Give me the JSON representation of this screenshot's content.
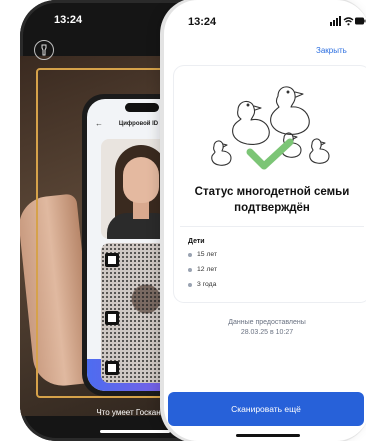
{
  "back_phone": {
    "status_time": "13:24",
    "scanned_screen_title": "Цифровой ID",
    "caption": "Что умеет Госкан"
  },
  "front_phone": {
    "status_time": "13:24",
    "close_label": "Закрыть",
    "status_title_line1": "Статус многодетной семьи",
    "status_title_line2": "подтверждён",
    "children_title": "Дети",
    "children": [
      "15 лет",
      "12 лет",
      "3 года"
    ],
    "provided_line1": "Данные предоставлены",
    "provided_line2": "28.03.25 в 10:27",
    "scan_again_label": "Сканировать ещё"
  },
  "colors": {
    "accent_blue": "#2761d9",
    "check_green": "#7cc576",
    "scan_frame": "#d6a24a"
  },
  "icons": [
    "flashlight-icon",
    "signal-icon",
    "wifi-icon",
    "battery-icon",
    "checkmark-icon",
    "info-icon",
    "back-arrow-icon"
  ]
}
